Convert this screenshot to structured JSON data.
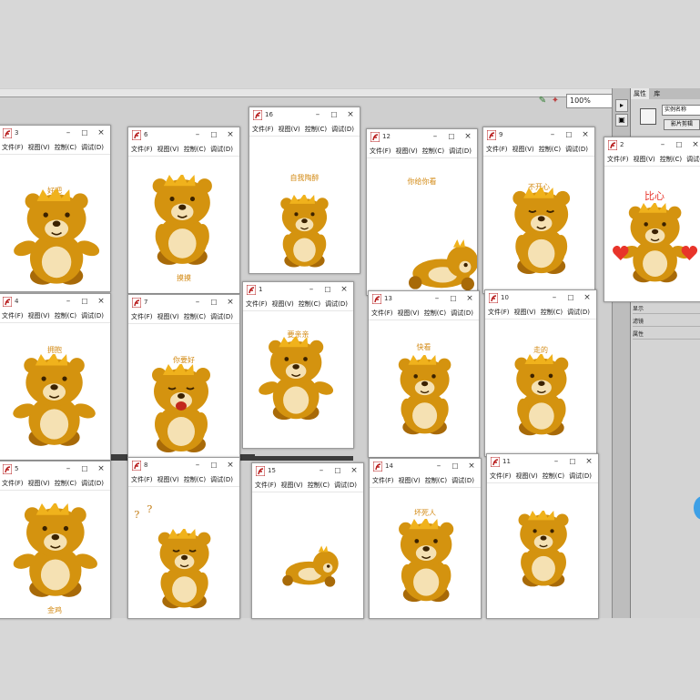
{
  "toolbar": {
    "zoom": "100%"
  },
  "panel": {
    "tabs": [
      "属性",
      "库"
    ],
    "field_text": "实例名称",
    "button_text": "影片剪辑",
    "rows": [
      "显示",
      "滤镜",
      "属性"
    ]
  },
  "menus": {
    "standard": [
      "文件(F)",
      "视图(V)",
      "控制(C)",
      "调试(D)"
    ]
  },
  "windows": [
    {
      "num": "3",
      "caption": "好吧"
    },
    {
      "num": "6",
      "caption": "摸摸"
    },
    {
      "num": "16",
      "caption": "自我陶醉"
    },
    {
      "num": "12",
      "caption": "你给你看"
    },
    {
      "num": "9",
      "caption": "不开心"
    },
    {
      "num": "2",
      "caption": "比心"
    },
    {
      "num": "4",
      "caption": "拥抱"
    },
    {
      "num": "7",
      "caption": "你要好"
    },
    {
      "num": "1",
      "caption": "要亲亲"
    },
    {
      "num": "13",
      "caption": "快看"
    },
    {
      "num": "10",
      "caption": "走的"
    },
    {
      "num": "5",
      "caption": "金鸡"
    },
    {
      "num": "8",
      "caption": ""
    },
    {
      "num": "15",
      "caption": ""
    },
    {
      "num": "14",
      "caption": "坏死人"
    },
    {
      "num": "11",
      "caption": ""
    }
  ]
}
